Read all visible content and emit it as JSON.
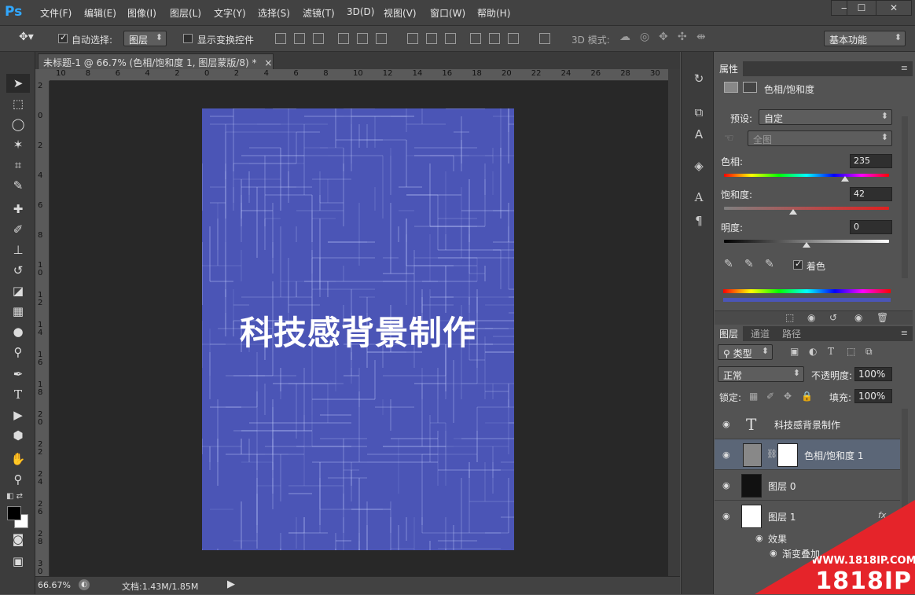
{
  "app": {
    "logo": "Ps"
  },
  "menu": [
    "文件(F)",
    "编辑(E)",
    "图像(I)",
    "图层(L)",
    "文字(Y)",
    "选择(S)",
    "滤镜(T)",
    "3D(D)",
    "视图(V)",
    "窗口(W)",
    "帮助(H)"
  ],
  "window_controls": {
    "minimize": "—",
    "maximize": "☐",
    "close": "✕"
  },
  "options": {
    "auto_select_label": "自动选择:",
    "auto_select_checked": true,
    "auto_select_target": "图层",
    "show_transform_label": "显示变换控件",
    "show_transform_checked": false,
    "mode3d_label": "3D 模式:",
    "workspace": "基本功能"
  },
  "document": {
    "tab_title": "未标题-1 @ 66.7% (色相/饱和度 1, 图层蒙版/8) *",
    "tab_close": "×",
    "headline": "科技感背景制作",
    "background_color": "#4b55b6"
  },
  "rulers": {
    "h_ticks": [
      "10",
      "8",
      "6",
      "4",
      "2",
      "0",
      "2",
      "4",
      "6",
      "8",
      "10",
      "12",
      "14",
      "16",
      "18",
      "20",
      "22",
      "24",
      "26",
      "28",
      "30"
    ],
    "v_ticks": [
      "2",
      "0",
      "2",
      "4",
      "6",
      "8",
      "10",
      "12",
      "14",
      "16",
      "18",
      "20",
      "22",
      "24",
      "26",
      "28",
      "30"
    ]
  },
  "status": {
    "zoom": "66.67%",
    "doc_info": "文档:1.43M/1.85M"
  },
  "properties": {
    "tab": "属性",
    "title": "色相/饱和度",
    "preset_label": "预设:",
    "preset_value": "自定",
    "channel_value": "全图",
    "hue_label": "色相:",
    "hue_value": "235",
    "saturation_label": "饱和度:",
    "saturation_value": "42",
    "lightness_label": "明度:",
    "lightness_value": "0",
    "colorize_label": "着色",
    "colorize_checked": true,
    "hue_position": 0.735,
    "saturation_position": 0.42,
    "lightness_position": 0.5
  },
  "layers_panel": {
    "tabs": [
      "图层",
      "通道",
      "路径"
    ],
    "filter_label": "类型",
    "blend_mode": "正常",
    "opacity_label": "不透明度:",
    "opacity_value": "100%",
    "lock_label": "锁定:",
    "fill_label": "填充:",
    "fill_value": "100%",
    "layers": [
      {
        "name": "科技感背景制作",
        "type": "text"
      },
      {
        "name": "色相/饱和度 1",
        "type": "adjustment",
        "selected": true
      },
      {
        "name": "图层 0",
        "type": "pixel"
      },
      {
        "name": "图层 1",
        "type": "pixel"
      }
    ],
    "effects_label": "效果",
    "effect_item": "渐变叠加"
  },
  "watermark": {
    "url": "WWW.1818IP.COM",
    "brand": "1818IP"
  }
}
